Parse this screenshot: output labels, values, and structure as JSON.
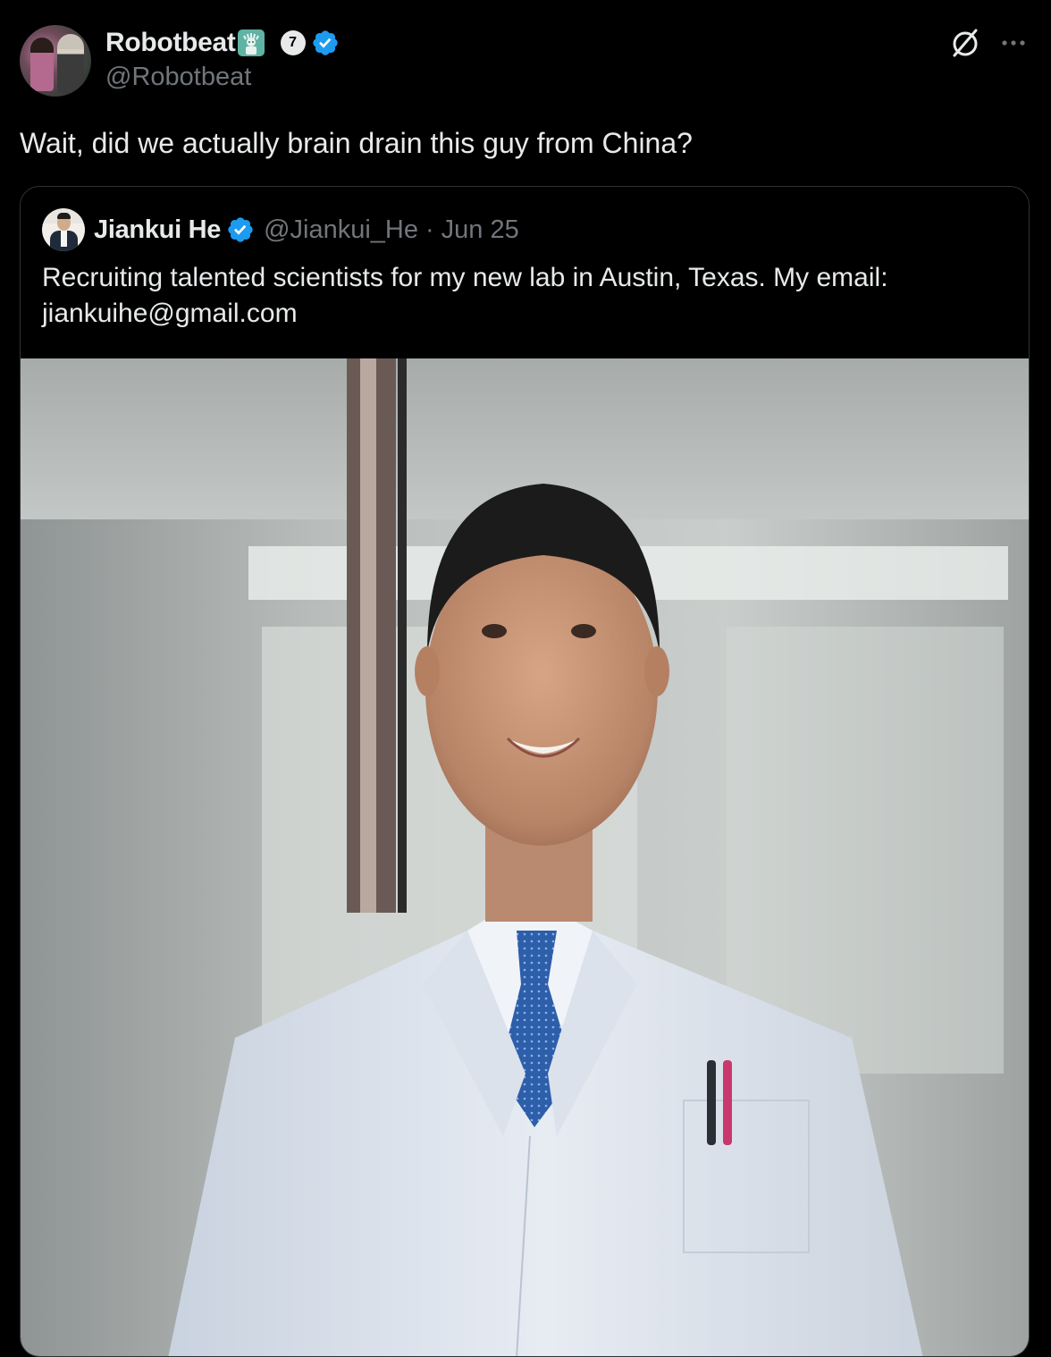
{
  "tweet": {
    "author": {
      "display_name": "Robotbeat",
      "name_emoji": "statue-of-liberty-emoji",
      "badge_number": "7",
      "handle": "@Robotbeat"
    },
    "text": "Wait, did we actually brain drain this guy from China?",
    "actions": {
      "grok_icon": "grok-icon",
      "more_icon": "more-icon"
    }
  },
  "quote": {
    "author": {
      "display_name": "Jiankui He",
      "handle": "@Jiankui_He",
      "separator": "·",
      "date": "Jun 25"
    },
    "text": "Recruiting talented scientists for my new lab in Austin, Texas. My email: jiankuihe@gmail.com",
    "media": {
      "kind": "photo"
    }
  },
  "colors": {
    "background": "#000000",
    "primary_text": "#e7e9ea",
    "secondary_text": "#71767b",
    "border": "#2f3336",
    "verified_blue": "#1d9bf0"
  }
}
